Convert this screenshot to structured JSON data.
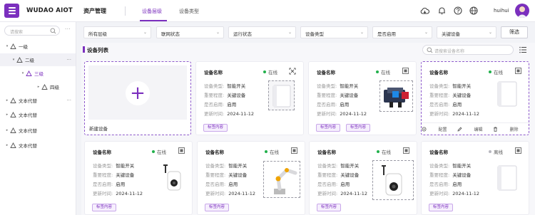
{
  "header": {
    "brand": "WUDAO AIOT",
    "app_title": "资产管理",
    "tabs": [
      "设备层级",
      "设备类型"
    ],
    "username": "huihui",
    "icons": [
      "cloud-icon",
      "bell-icon",
      "help-icon",
      "globe-icon"
    ],
    "accent": "#7b2fbe"
  },
  "sidebar": {
    "search_placeholder": "请搜索",
    "more": "···",
    "tree": [
      {
        "label": "一级",
        "arrow": "▾",
        "selected": false
      },
      {
        "label": "二级",
        "arrow": "▾",
        "selected": false
      },
      {
        "label": "三级",
        "arrow": "▾",
        "selected": true
      },
      {
        "label": "四级",
        "arrow": "▸",
        "selected": false
      },
      {
        "label": "文本代替",
        "arrow": "▸",
        "selected": false
      },
      {
        "label": "文本代替",
        "arrow": "▸",
        "selected": false
      },
      {
        "label": "文本代替",
        "arrow": "▸",
        "selected": false
      },
      {
        "label": "文本代替",
        "arrow": "▸",
        "selected": false
      }
    ]
  },
  "filters": {
    "items": [
      "所有层级",
      "联网状态",
      "运行状态",
      "设备类型",
      "是否启用",
      "关键设备"
    ],
    "button": "筛选"
  },
  "list": {
    "title": "设备列表",
    "search_placeholder": "请搜索设备名称",
    "new_device_label": "新建设备",
    "field_labels": {
      "type": "设备类型:",
      "importance": "重要程度:",
      "enabled": "是否启用:",
      "updated": "更新时间:"
    },
    "actions": [
      "配置",
      "编辑",
      "删除"
    ],
    "cards": [
      {
        "name": "设备名称",
        "status": "在线",
        "status_color": "#22b14c",
        "type": "智能开关",
        "importance": "关键设备",
        "enabled": "启用",
        "updated": "2024-11-12",
        "tag": "标签内容",
        "image": "box"
      },
      {
        "name": "设备名称",
        "status": "在线",
        "status_color": "#22b14c",
        "type": "智能开关",
        "importance": "关键设备",
        "enabled": "启用",
        "updated": "2024-11-12",
        "tag": "标签内容",
        "image": "robot"
      },
      {
        "name": "设备名称",
        "status": "在线",
        "status_color": "#22b14c",
        "type": "智能开关",
        "importance": "关键设备",
        "enabled": "启用",
        "updated": "2024-11-12",
        "tag": "标签内容",
        "image": "box"
      },
      {
        "name": "设备名称",
        "status": "在线",
        "status_color": "#22b14c",
        "type": "智能开关",
        "importance": "关键设备",
        "enabled": "启用",
        "updated": "2024-11-12",
        "tag": "标签内容",
        "image": "camera"
      },
      {
        "name": "设备名称",
        "status": "在线",
        "status_color": "#22b14c",
        "type": "智能开关",
        "importance": "关键设备",
        "enabled": "启用",
        "updated": "2024-11-12",
        "tag": "标签内容",
        "image": "arm"
      },
      {
        "name": "设备名称",
        "status": "在线",
        "status_color": "#22b14c",
        "type": "智能开关",
        "importance": "关键设备",
        "enabled": "启用",
        "updated": "2024-11-12",
        "tag": "标签内容",
        "image": "camera"
      },
      {
        "name": "设备名称",
        "status": "离线",
        "status_color": "#b8b8c0",
        "type": "智能开关",
        "importance": "关键设备",
        "enabled": "启用",
        "updated": "2024-11-12",
        "tag": "标签内容",
        "image": "box"
      }
    ]
  }
}
